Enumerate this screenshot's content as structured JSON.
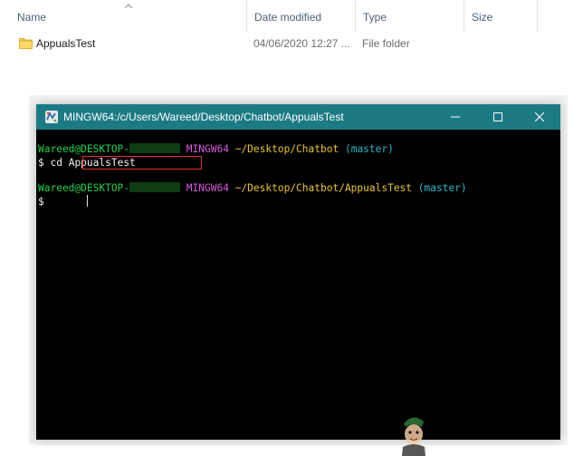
{
  "explorer": {
    "columns": [
      "Name",
      "Date modified",
      "Type",
      "Size"
    ],
    "row": {
      "name": "AppualsTest",
      "date": "04/06/2020 12:27 ...",
      "type": "File folder"
    }
  },
  "terminal": {
    "title": "MINGW64:/c/Users/Wareed/Desktop/Chatbot/AppualsTest",
    "line1": {
      "user": "Wareed@DESKTOP-",
      "system": "MINGW64",
      "path": "~/Desktop/Chatbot",
      "branch": "(master)"
    },
    "line2": {
      "prompt": "$",
      "command": "cd AppualsTest"
    },
    "line3": {
      "user": "Wareed@DESKTOP-",
      "system": "MINGW64",
      "path": "~/Desktop/Chatbot/AppualsTest",
      "branch": "(master)"
    },
    "line4": {
      "prompt": "$"
    }
  },
  "colors": {
    "titlebar": "#1b7a84",
    "user": "#23d14b",
    "system": "#d65adb",
    "path": "#e6c534",
    "branch": "#29b8c9",
    "highlight": "#e0302a"
  },
  "icons": {
    "folder": "folder-icon",
    "app": "mingw-icon",
    "minimize": "minimize-icon",
    "maximize": "maximize-icon",
    "close": "close-icon"
  }
}
